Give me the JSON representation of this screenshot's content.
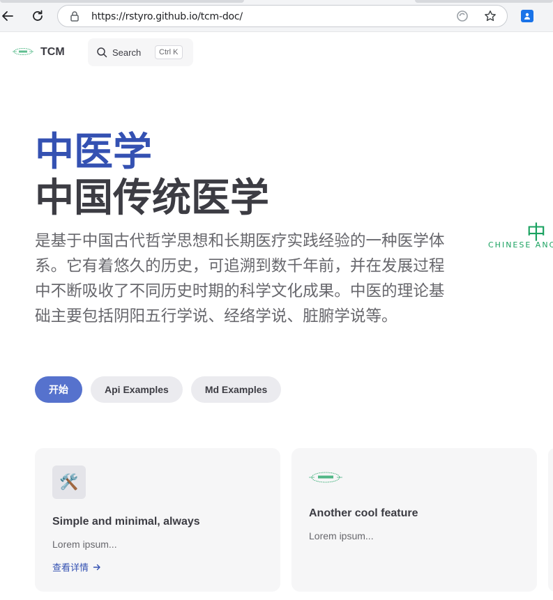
{
  "browser": {
    "url": "https://rstyro.github.io/tcm-doc/",
    "icons": [
      "back-arrow-icon",
      "reload-icon",
      "lock-icon",
      "reader-icon",
      "star-icon",
      "profile-icon"
    ]
  },
  "nav": {
    "site_title": "TCM",
    "search_label": "Search",
    "search_shortcut": "Ctrl K"
  },
  "hero": {
    "name": "中医学",
    "text": "中国传统医学",
    "tagline": "是基于中国古代哲学思想和长期医疗实践经验的一种医学体系。它有着悠久的历史，可追溯到数千年前，并在发展过程中不断吸收了不同历史时期的科学文化成果。中医的理论基础主要包括阴阳五行学说、经络学说、脏腑学说等。",
    "image_text_big": "中",
    "image_text_small": "CHINESE ANC",
    "actions": [
      {
        "label": "开始"
      },
      {
        "label": "Api Examples"
      },
      {
        "label": "Md Examples"
      }
    ]
  },
  "features": [
    {
      "icon": "🛠️",
      "title": "Simple and minimal, always",
      "details": "Lorem ipsum...",
      "link_text": "查看详情"
    },
    {
      "title": "Another cool feature",
      "details": "Lorem ipsum..."
    }
  ],
  "colors": {
    "brand": "#3451b2",
    "brand_button": "#5672cd",
    "text": "#3c3c43",
    "muted": "#67676c",
    "card_bg": "#f6f6f7",
    "logo_green": "#1aa260"
  }
}
